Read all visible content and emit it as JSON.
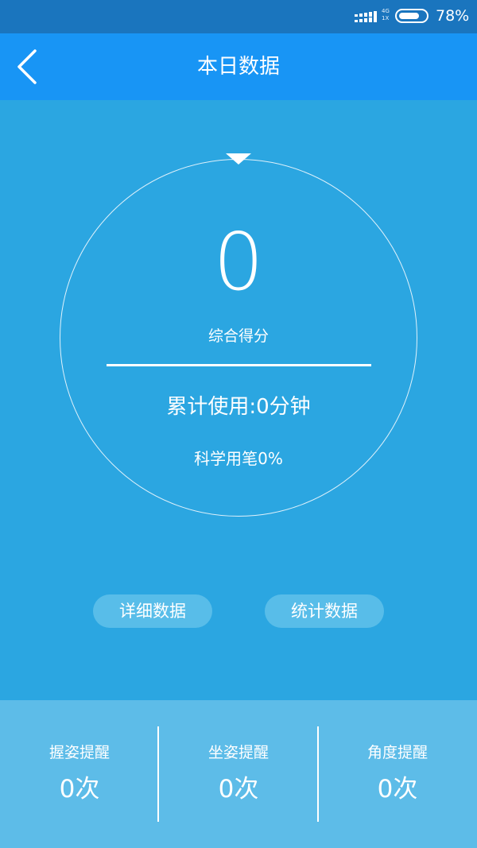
{
  "status_bar": {
    "network_label_top": "4G",
    "network_label_bottom": "1X",
    "battery_percent_value": 78,
    "battery_text": "78%",
    "signal_icon": "signal-strength-icon",
    "battery_icon": "battery-icon"
  },
  "header": {
    "title": "本日数据",
    "back_icon": "chevron-left-icon"
  },
  "dial": {
    "score": "0",
    "score_label": "综合得分",
    "usage_text": "累计使用:0分钟",
    "science_text": "科学用笔0%"
  },
  "actions": {
    "detail_label": "详细数据",
    "stats_label": "统计数据"
  },
  "stats": [
    {
      "label": "握姿提醒",
      "value": "0次"
    },
    {
      "label": "坐姿提醒",
      "value": "0次"
    },
    {
      "label": "角度提醒",
      "value": "0次"
    }
  ],
  "colors": {
    "status_bar": "#1A75BE",
    "header": "#1895F5",
    "background": "#2BA6E1",
    "button": "#58BDE9",
    "bottom_panel": "#5DBCE8",
    "text": "#FFFFFF"
  }
}
